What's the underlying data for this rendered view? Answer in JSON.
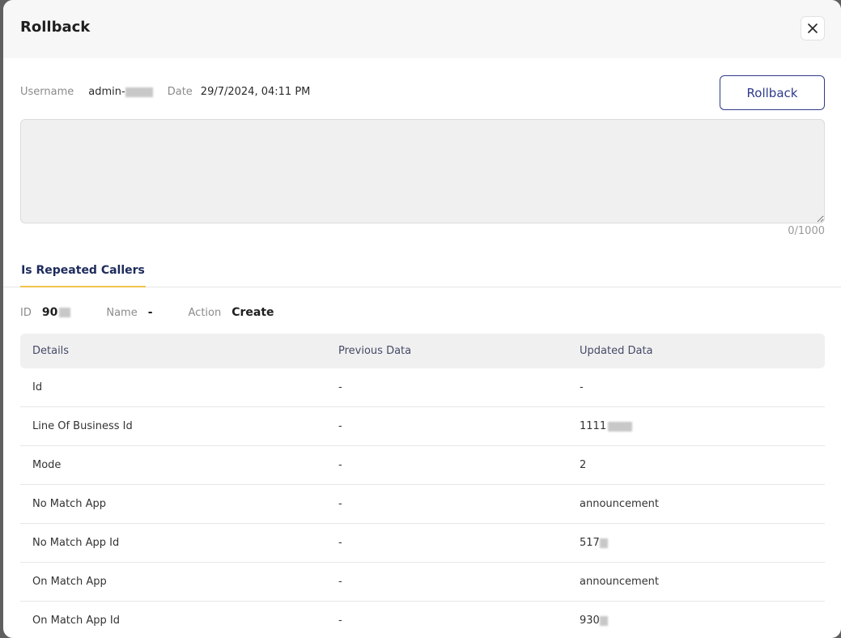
{
  "modal": {
    "title": "Rollback"
  },
  "meta": {
    "username_label": "Username",
    "username_value": "admin-",
    "date_label": "Date",
    "date_value": "29/7/2024, 04:11 PM"
  },
  "actions": {
    "rollback_label": "Rollback"
  },
  "comment": {
    "value": "",
    "placeholder": "",
    "counter": "0/1000"
  },
  "tabs": [
    {
      "label": "Is Repeated Callers",
      "active": true
    }
  ],
  "record": {
    "id_label": "ID",
    "id_value": "90",
    "name_label": "Name",
    "name_value": "-",
    "action_label": "Action",
    "action_value": "Create"
  },
  "table": {
    "columns": [
      "Details",
      "Previous Data",
      "Updated Data"
    ],
    "rows": [
      [
        "Id",
        "-",
        "-"
      ],
      [
        "Line Of Business Id",
        "-",
        "1111"
      ],
      [
        "Mode",
        "-",
        "2"
      ],
      [
        "No Match App",
        "-",
        "announcement"
      ],
      [
        "No Match App Id",
        "-",
        "517"
      ],
      [
        "On Match App",
        "-",
        "announcement"
      ],
      [
        "On Match App Id",
        "-",
        "930"
      ]
    ]
  },
  "colors": {
    "accent": "#2e3a8c",
    "tab_underline": "#f0c34a"
  }
}
